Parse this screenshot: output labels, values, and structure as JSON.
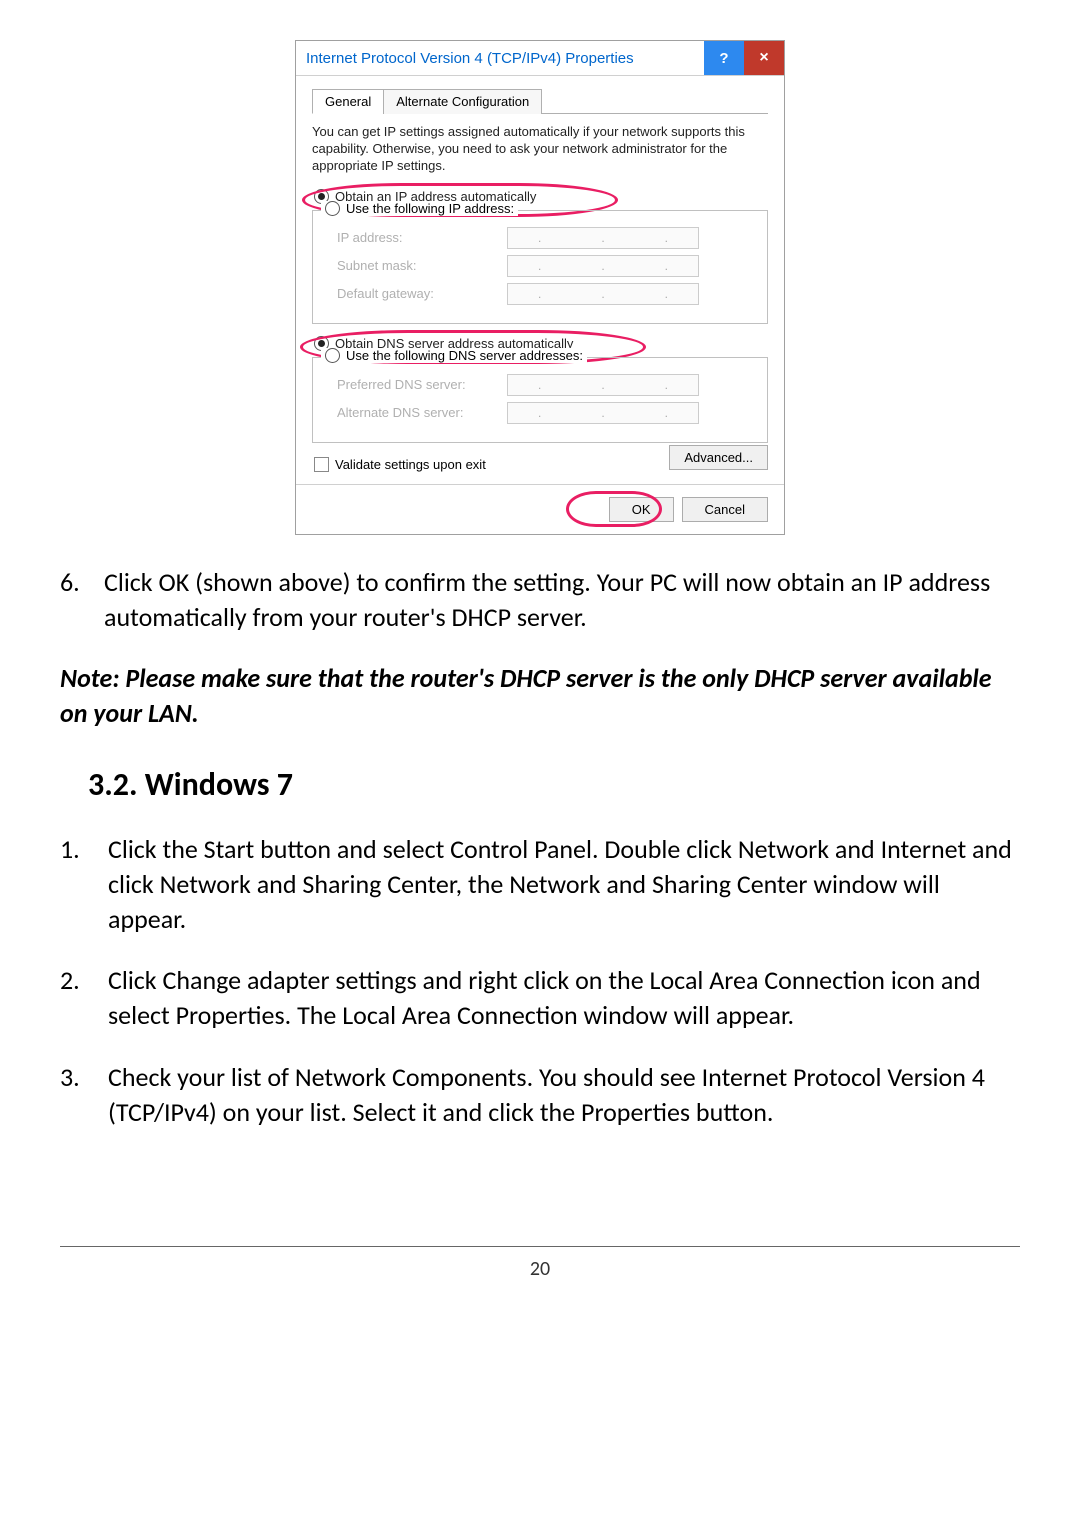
{
  "dialog": {
    "title": "Internet Protocol Version 4 (TCP/IPv4) Properties",
    "help": "?",
    "close": "×",
    "tabs": {
      "general": "General",
      "alternate": "Alternate Configuration"
    },
    "description": "You can get IP settings assigned automatically if your network supports this capability. Otherwise, you need to ask your network administrator for the appropriate IP settings.",
    "ip": {
      "auto": "Obtain an IP address automatically",
      "manual": "Use the following IP address:",
      "address": "IP address:",
      "subnet": "Subnet mask:",
      "gateway": "Default gateway:"
    },
    "dns": {
      "auto": "Obtain DNS server address automatically",
      "manual": "Use the following DNS server addresses:",
      "preferred": "Preferred DNS server:",
      "alternate": "Alternate DNS server:"
    },
    "validate": "Validate settings upon exit",
    "advanced": "Advanced...",
    "ok": "OK",
    "cancel": "Cancel"
  },
  "doc": {
    "step6_num": "6.",
    "step6_text": "Click OK (shown above) to confirm the setting. Your PC will now obtain an IP address automatically from your router's DHCP server.",
    "note": "Note: Please make sure that the router's DHCP server is the only DHCP server available on your LAN.",
    "heading": "3.2. Windows 7",
    "step1_num": "1.",
    "step1_text": "Click the Start button and select Control Panel.  Double click Network and Internet and click Network and Sharing Center, the Network and Sharing Center window will appear.",
    "step2_num": "2.",
    "step2_text": "Click Change adapter settings and right click on the Local Area Connection icon and select Properties. The Local Area Connection window will appear.",
    "step3_num": "3.",
    "step3_text": "Check your list of Network Components. You should see Internet Protocol Version 4 (TCP/IPv4) on your list. Select it and click the Properties button.",
    "page_number": "20"
  }
}
